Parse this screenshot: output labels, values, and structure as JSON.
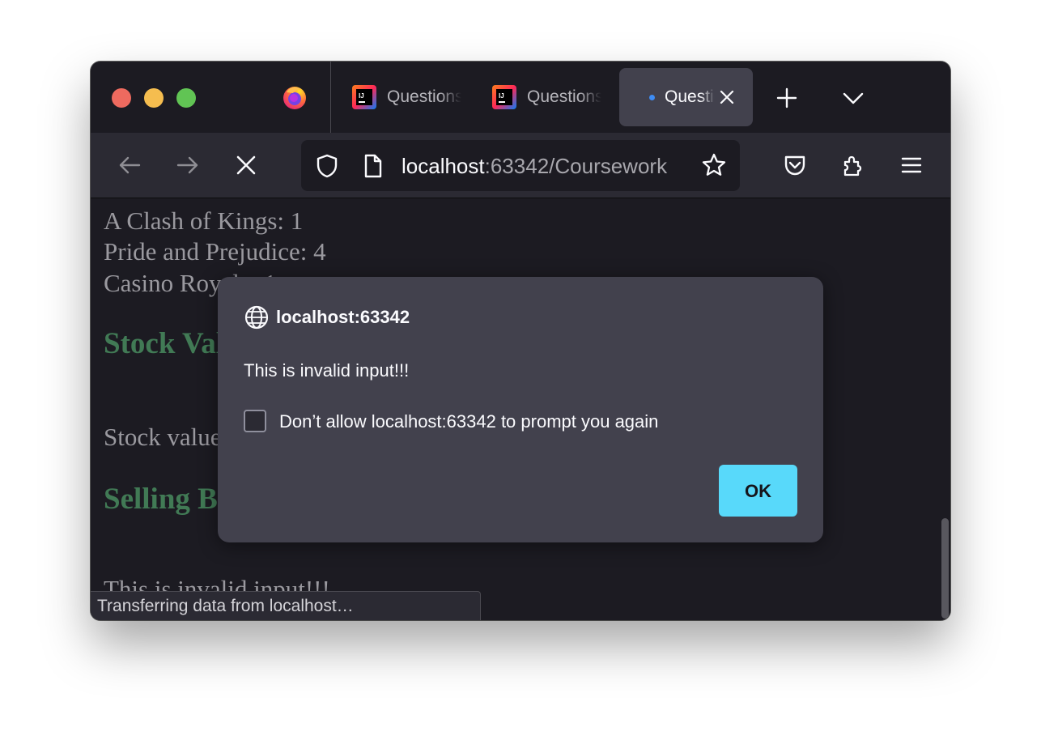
{
  "tabs": [
    {
      "label": "Questions",
      "icon": "intellij-icon",
      "active": false
    },
    {
      "label": "Questions",
      "icon": "intellij-icon",
      "active": false
    },
    {
      "label": "Questions",
      "icon": "loading-dot-icon",
      "active": true
    }
  ],
  "urlbar": {
    "host": "localhost",
    "rest": ":63342/Coursework"
  },
  "page": {
    "lines": [
      "A Clash of Kings: 1",
      "Pride and Prejudice: 4",
      "Casino Royale: 1"
    ],
    "heading_stock": "Stock Value",
    "stock_value_text": "Stock value",
    "heading_selling": "Selling Books",
    "invalid_text": "This is invalid input!!!"
  },
  "status": {
    "text": "Transferring data from localhost…"
  },
  "dialog": {
    "title": "localhost:63342",
    "message": "This is invalid input!!!",
    "checkbox_label": "Don’t allow localhost:63342 to prompt you again",
    "checkbox_checked": false,
    "ok_label": "OK"
  },
  "colors": {
    "ok_button": "#58d9fa",
    "heading_green": "#417a55",
    "dialog_bg": "#42414d"
  }
}
